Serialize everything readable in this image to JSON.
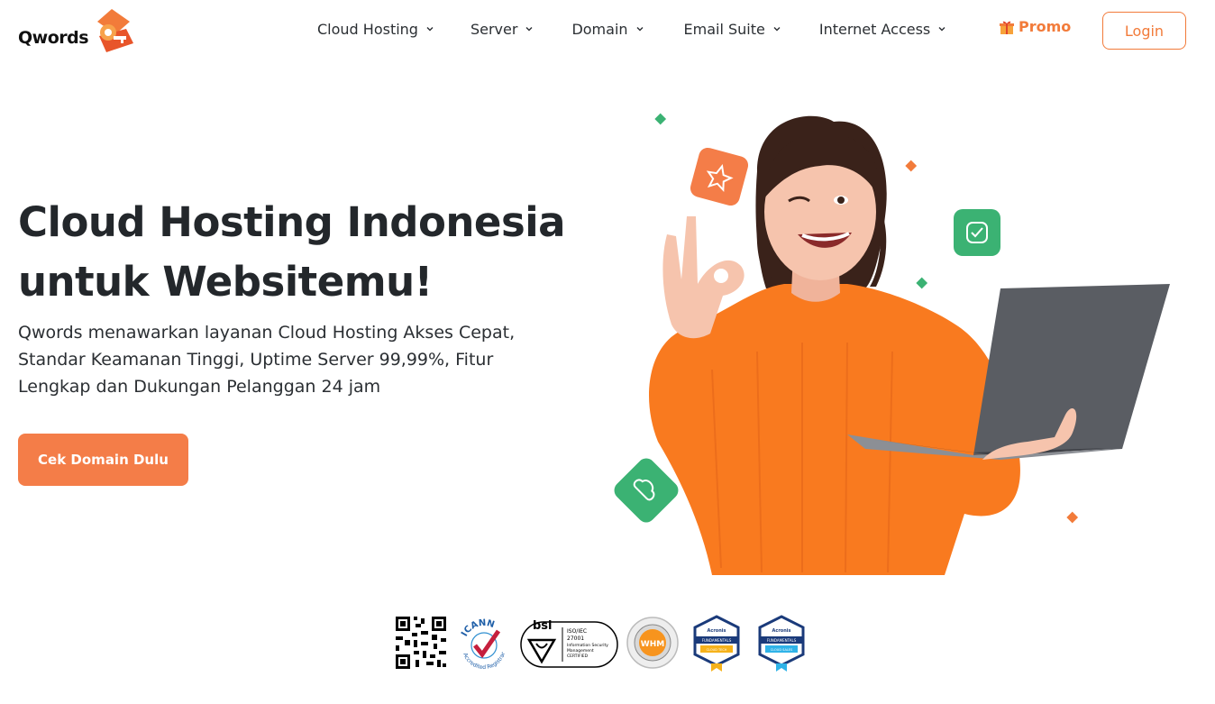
{
  "brand": {
    "name": "Qwords",
    "accent": "#f27b3a",
    "green": "#3bb273"
  },
  "nav": {
    "items": [
      {
        "label": "Cloud Hosting",
        "icon": "chevron-down-icon"
      },
      {
        "label": "Server",
        "icon": "chevron-down-icon"
      },
      {
        "label": "Domain",
        "icon": "chevron-down-icon"
      },
      {
        "label": "Email Suite",
        "icon": "chevron-down-icon"
      },
      {
        "label": "Internet Access",
        "icon": "chevron-down-icon"
      }
    ],
    "promo": {
      "label": "Promo",
      "icon": "gift-icon"
    },
    "login": "Login"
  },
  "hero": {
    "title_line1": "Cloud Hosting Indonesia",
    "title_line2": "untuk Websitemu!",
    "desc_line1": "Qwords menawarkan layanan Cloud Hosting Akses Cepat,",
    "desc_line2": "Standar Keamanan Tinggi, Uptime Server 99,99%, Fitur",
    "desc_line3": "Lengkap dan Dukungan Pelanggan 24 jam",
    "cta": "Cek Domain Dulu"
  },
  "badges": {
    "icann_top": "ICANN",
    "icann_bottom": "Accredited Registrar",
    "bsi": "bsi",
    "iso_line1": "ISO/IEC",
    "iso_line2": "27001",
    "iso_line3": "Information Security",
    "iso_line4": "Management",
    "iso_line5": "CERTIFIED",
    "whm": "WHM",
    "acronis1_brand": "Acronis",
    "acronis1_tag": "FUNDAMENTALS",
    "acronis1_sub": "CLOUD TECH",
    "acronis2_brand": "Acronis",
    "acronis2_tag": "FUNDAMENTALS",
    "acronis2_sub": "CLOUD SALES"
  }
}
